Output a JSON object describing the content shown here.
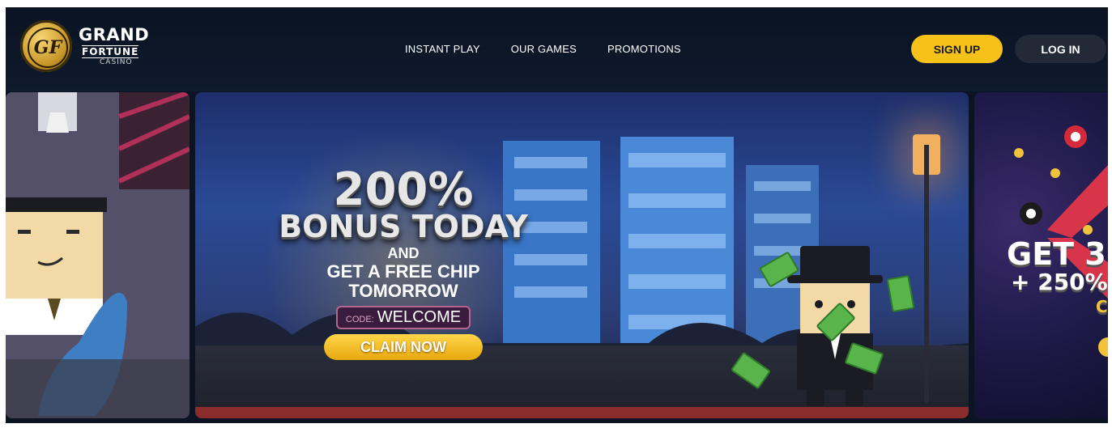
{
  "brand": {
    "line1": "GRAND",
    "line2": "FORTUNE",
    "line3": "CASINO",
    "monogram": "GF"
  },
  "nav": {
    "items": [
      "INSTANT PLAY",
      "OUR GAMES",
      "PROMOTIONS"
    ]
  },
  "auth": {
    "signup_label": "SIGN UP",
    "login_label": "LOG IN"
  },
  "hero": {
    "main_slide": {
      "headline_pct": "200%",
      "headline_bonus": "BONUS TODAY",
      "and_text": "AND",
      "subline_1": "GET A FREE CHIP",
      "subline_2": "TOMORROW",
      "code_label": "CODE:",
      "code_value": "WELCOME",
      "cta_label": "CLAIM NOW"
    },
    "right_slide": {
      "line1": "GET 3",
      "line2": "+ 250%",
      "line3": "C"
    }
  },
  "colors": {
    "accent": "#f6c21a",
    "header_bg": "#0c1424",
    "login_bg": "#222a38"
  },
  "icons": {
    "logo": "gold-coin-monogram-icon"
  }
}
